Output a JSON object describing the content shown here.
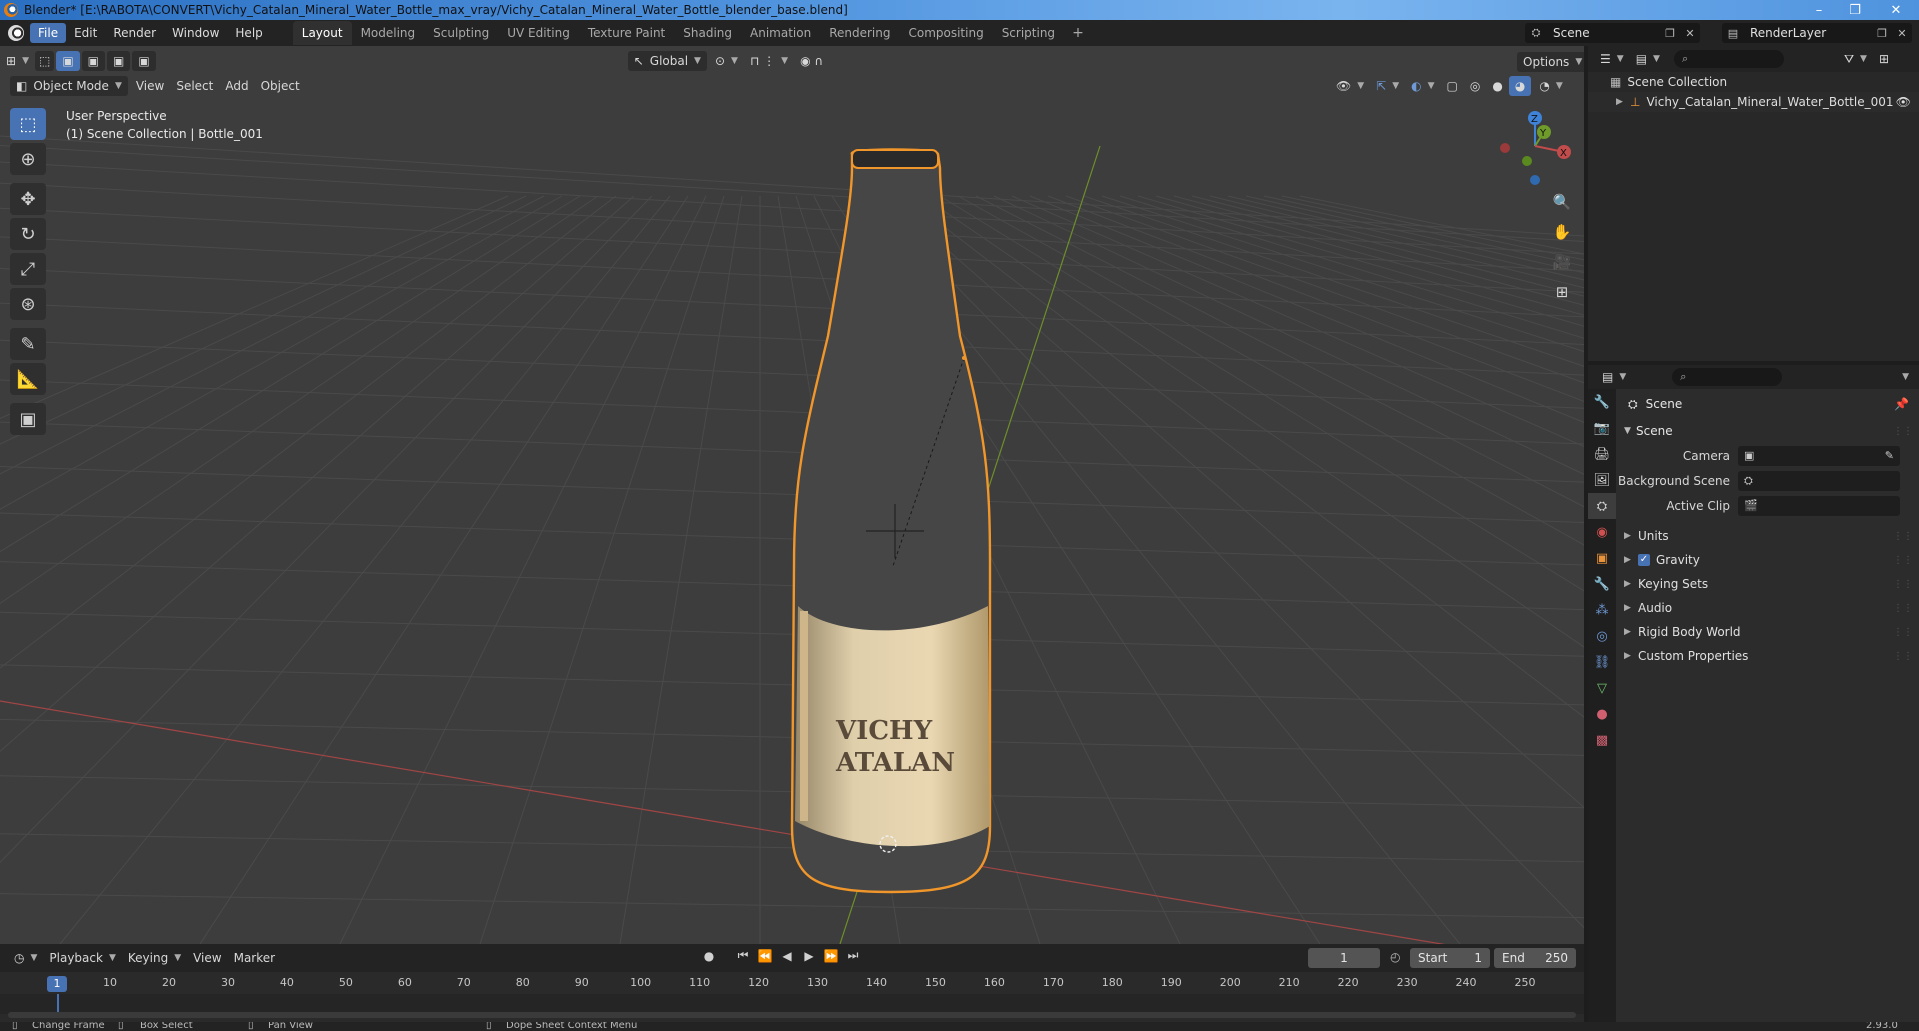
{
  "window": {
    "title": "Blender* [E:\\RABOTA\\CONVERT\\Vichy_Catalan_Mineral_Water_Bottle_max_vray/Vichy_Catalan_Mineral_Water_Bottle_blender_base.blend]",
    "controls": [
      "–",
      "❐",
      "✕"
    ]
  },
  "menu": [
    "File",
    "Edit",
    "Render",
    "Window",
    "Help"
  ],
  "workspaces": [
    "Layout",
    "Modeling",
    "Sculpting",
    "UV Editing",
    "Texture Paint",
    "Shading",
    "Animation",
    "Rendering",
    "Compositing",
    "Scripting"
  ],
  "workspace_add": "+",
  "scene_selector": "Scene",
  "layer_selector": "RenderLayer",
  "viewport": {
    "mode": "Object Mode",
    "menus": [
      "View",
      "Select",
      "Add",
      "Object"
    ],
    "orientation": "Global",
    "options_label": "Options",
    "info_line1": "User Perspective",
    "info_line2": "(1) Scene Collection | Bottle_001",
    "gizmo_axes": [
      "Z",
      "Y",
      "X"
    ],
    "label_lines": [
      "VICHY",
      "ATALAN"
    ]
  },
  "timeline": {
    "menus": [
      "Playback",
      "Keying",
      "View",
      "Marker"
    ],
    "current_frame": "1",
    "start_label": "Start",
    "start_value": "1",
    "end_label": "End",
    "end_value": "250",
    "ruler": [
      "1",
      "10",
      "20",
      "30",
      "40",
      "50",
      "60",
      "70",
      "80",
      "90",
      "100",
      "110",
      "120",
      "130",
      "140",
      "150",
      "160",
      "170",
      "180",
      "190",
      "200",
      "210",
      "220",
      "230",
      "240",
      "250"
    ]
  },
  "statusbar": {
    "items": [
      "Change Frame",
      "Box Select",
      "Pan View",
      "Dope Sheet Context Menu"
    ],
    "version": "2.93.0"
  },
  "outliner": {
    "root": "Scene Collection",
    "items": [
      "Vichy_Catalan_Mineral_Water_Bottle_001"
    ]
  },
  "properties": {
    "context": "Scene",
    "panel_title": "Scene",
    "fields": [
      {
        "label": "Camera",
        "value": ""
      },
      {
        "label": "Background Scene",
        "value": ""
      },
      {
        "label": "Active Clip",
        "value": ""
      }
    ],
    "subpanels": [
      "Units",
      "Gravity",
      "Keying Sets",
      "Audio",
      "Rigid Body World",
      "Custom Properties"
    ],
    "gravity_checked": true
  },
  "colors": {
    "accent": "#4772b3",
    "selection_outline": "#f0962a",
    "x_axis": "#c24b4b",
    "y_axis": "#6e9b2a",
    "z_axis": "#3f83d8"
  }
}
